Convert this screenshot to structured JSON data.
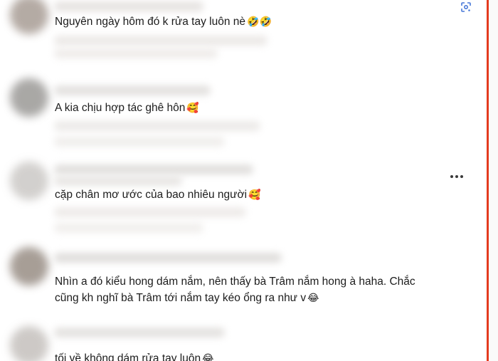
{
  "comments": [
    {
      "text": "Nguyên ngày hôm đó k rửa tay luôn nè",
      "emoji": "🤣🤣"
    },
    {
      "text": "A kia chịu hợp tác ghê hôn",
      "emoji": "🥰"
    },
    {
      "text": "cặp chân mơ ước của bao nhiêu người",
      "emoji": "🥰"
    },
    {
      "text": "Nhìn a đó kiểu hong dám nắm, nên thấy bà Trâm nắm hong à haha. Chắc cũng kh nghĩ bà Trâm tới nắm tay kéo ổng ra như v",
      "emoji": "😂"
    },
    {
      "text": "tối về không dám rửa tay luôn",
      "emoji": "😂"
    }
  ],
  "icons": {
    "more": "more-options-icon",
    "lens": "google-lens-icon"
  },
  "colors": {
    "accent_scrollbar": "#e43b1f",
    "lens_icon": "#4a79d8"
  }
}
